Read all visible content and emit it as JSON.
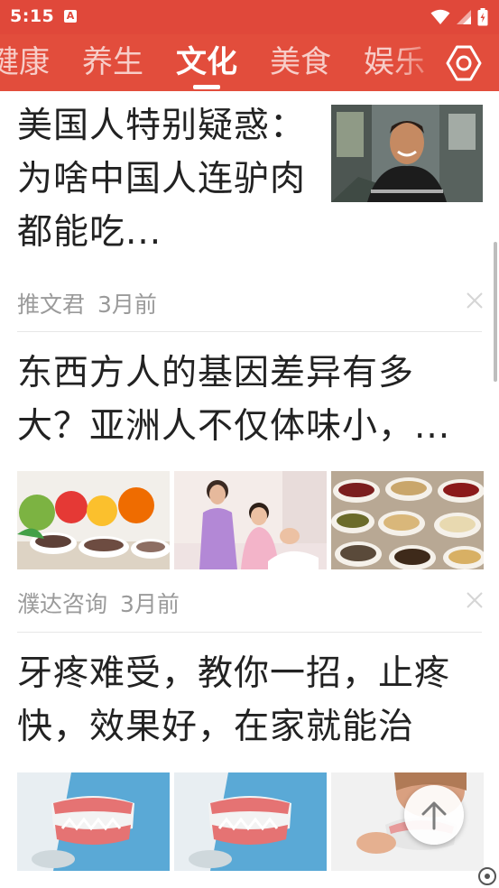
{
  "status_bar": {
    "time": "5:15",
    "notification_icon": "A"
  },
  "tabs": [
    {
      "label": "健康",
      "active": false
    },
    {
      "label": "养生",
      "active": false
    },
    {
      "label": "文化",
      "active": true
    },
    {
      "label": "美食",
      "active": false
    },
    {
      "label": "娱乐",
      "active": false
    }
  ],
  "articles": [
    {
      "title": "美国人特别疑惑：为啥中国人连驴肉都能吃...",
      "source": "推文君",
      "time": "3月前"
    },
    {
      "title": "东西方人的基因差异有多大？亚洲人不仅体味小，...",
      "source": "濮达咨询",
      "time": "3月前"
    },
    {
      "title": "牙疼难受，教你一招，止疼快，效果好，在家就能治"
    }
  ],
  "colors": {
    "header_red": "#e24d3c",
    "title_text": "#222222",
    "meta_text": "#9a9a9a"
  },
  "icons": {
    "settings": "settings-icon",
    "close": "close-icon",
    "scroll_top": "arrow-up-icon",
    "wifi": "wifi-icon",
    "signal": "signal-icon",
    "battery": "battery-icon"
  }
}
